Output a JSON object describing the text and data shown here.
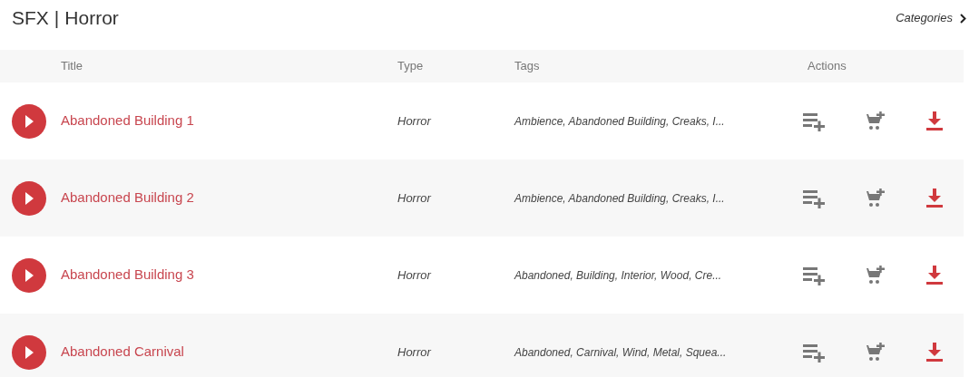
{
  "header": {
    "title": "SFX",
    "separator": "|",
    "category": "Horror",
    "categories_link": "Categories"
  },
  "table": {
    "columns": [
      "Title",
      "Type",
      "Tags",
      "Actions"
    ],
    "rows": [
      {
        "title": "Abandoned Building 1",
        "type": "Horror",
        "tags": "Ambience, Abandoned Building, Creaks, I..."
      },
      {
        "title": "Abandoned Building 2",
        "type": "Horror",
        "tags": "Ambience, Abandoned Building, Creaks, I..."
      },
      {
        "title": "Abandoned Building 3",
        "type": "Horror",
        "tags": "Abandoned, Building, Interior, Wood, Cre..."
      },
      {
        "title": "Abandoned Carnival",
        "type": "Horror",
        "tags": "Abandoned, Carnival, Wind, Metal, Squea..."
      }
    ]
  }
}
